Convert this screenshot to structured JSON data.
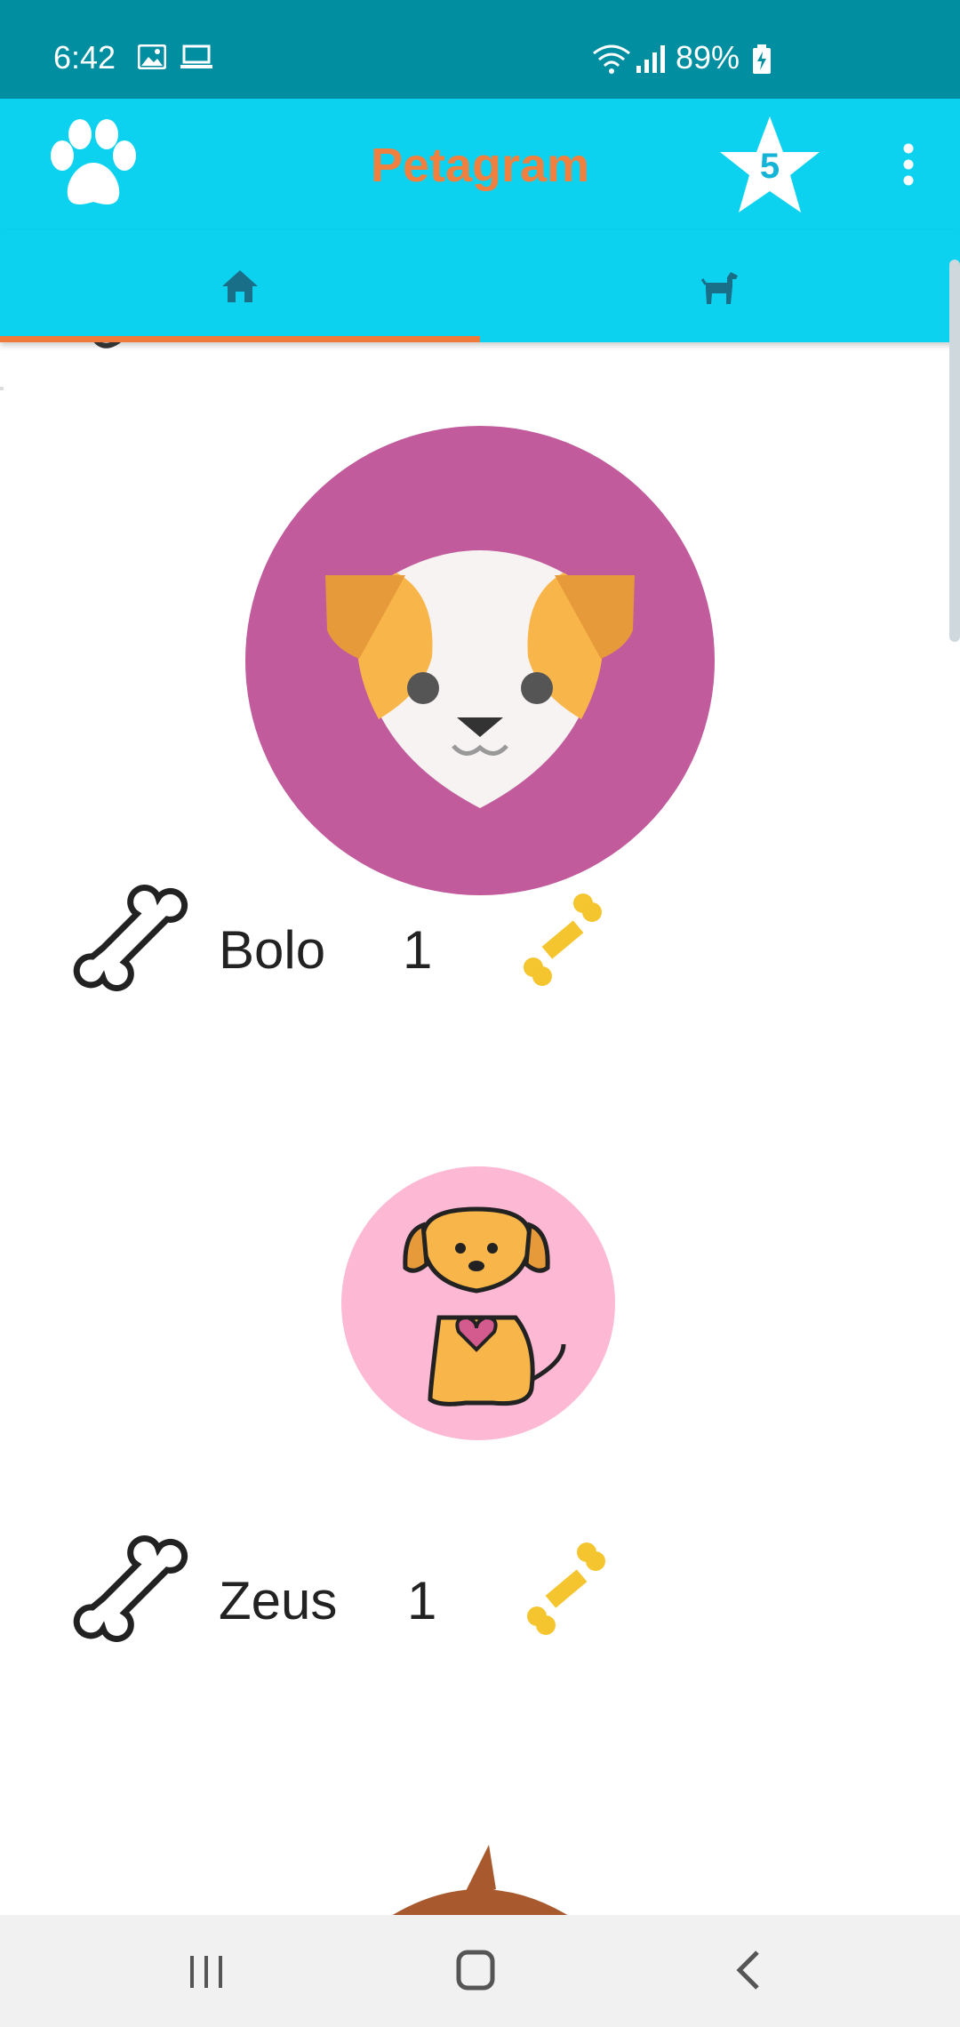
{
  "status_bar": {
    "time": "6:42",
    "battery_percent": "89%"
  },
  "app_bar": {
    "title": "Petagram",
    "star_badge_count": "5",
    "colors": {
      "bar": "#0dd2ef",
      "title": "#f08040",
      "status": "#008ea0"
    }
  },
  "tabs": [
    {
      "icon": "home-icon",
      "selected": true
    },
    {
      "icon": "dog-icon",
      "selected": false
    }
  ],
  "pets": [
    {
      "name": "Bolo",
      "likes": "1",
      "avatar": "puppy-face-avatar"
    },
    {
      "name": "Zeus",
      "likes": "1",
      "avatar": "sitting-puppy-avatar"
    }
  ],
  "nav_bar": {
    "buttons": [
      "recents-icon",
      "home-icon",
      "back-icon"
    ]
  }
}
